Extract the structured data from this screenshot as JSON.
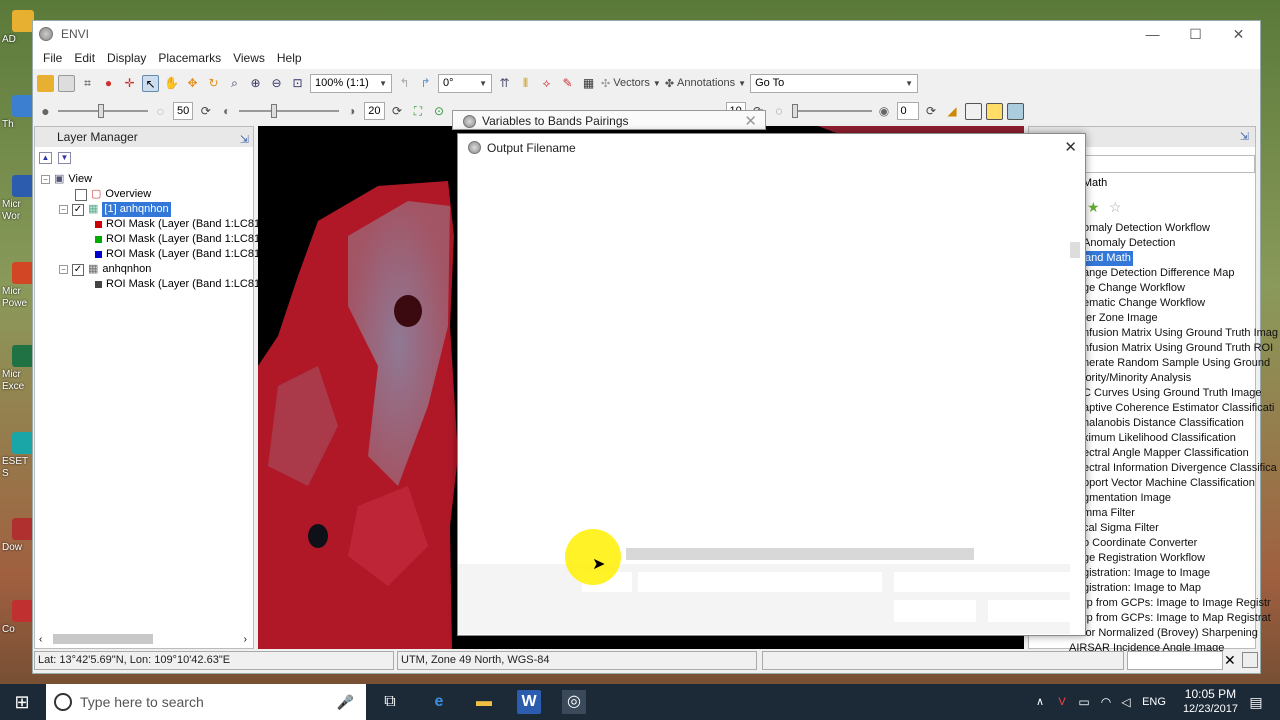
{
  "desktop": {
    "icons": [
      {
        "label": "AD",
        "color": "#e8b030"
      },
      {
        "label": "Th",
        "color": "#3c7fd0"
      },
      {
        "label": "Micr Wor",
        "color": "#2b5cad"
      },
      {
        "label": "Micr Powe",
        "color": "#d24625"
      },
      {
        "label": "Micr Exce",
        "color": "#207245"
      },
      {
        "label": "ESET S",
        "color": "#1aa6a6"
      },
      {
        "label": "Dow",
        "color": "#b03030"
      },
      {
        "label": "Co",
        "color": "#c03030"
      }
    ]
  },
  "window": {
    "title": "ENVI",
    "minimize": "—",
    "maximize": "☐",
    "close": "✕"
  },
  "menu": [
    "File",
    "Edit",
    "Display",
    "Placemarks",
    "Views",
    "Help"
  ],
  "toolbar1": {
    "zoom": "100% (1:1)",
    "rotation": "0°",
    "vectors": "Vectors",
    "annotations": "Annotations",
    "goto": "Go To"
  },
  "toolbar2": {
    "brightness": "50",
    "contrast": "20",
    "sharpen": "10",
    "transparency": "0"
  },
  "layer_manager": {
    "title": "Layer Manager",
    "tree": {
      "view": "View",
      "overview": "Overview",
      "layer1": "[1] anhqnhon",
      "roi1": "ROI Mask (Layer (Band 1:LC81",
      "roi2": "ROI Mask (Layer (Band 1:LC81",
      "roi3": "ROI Mask (Layer (Band 1:LC81",
      "layer2": "anhqnhon",
      "roi4": "ROI Mask (Layer (Band 1:LC81"
    }
  },
  "toolbox": {
    "header": "ebra/Band Math",
    "items": [
      "omaly Detection Workflow",
      "Anomaly Detection",
      "and Math",
      "ange Detection Difference Map",
      "ge Change Workflow",
      "ematic Change Workflow",
      "fer Zone Image",
      "nfusion Matrix Using Ground Truth Imag",
      "nfusion Matrix Using Ground Truth ROI",
      "nerate Random Sample Using Ground",
      "jority/Minority Analysis",
      "C Curves Using Ground Truth Image",
      "aptive Coherence Estimator Classificati",
      "halanobis Distance Classification",
      "ximum Likelihood Classification",
      "ectral Angle Mapper Classification",
      "ectral Information Divergence Classifica",
      "pport Vector Machine Classification",
      "gmentation Image",
      "mma Filter",
      "cal Sigma Filter",
      "o Coordinate Converter",
      "ge Registration Workflow",
      "gistration: Image to Image",
      "gistration: Image to Map",
      "rp from GCPs: Image to Image Registr",
      "rp from GCPs: Image to Map Registrat",
      "Color Normalized (Brovey) Sharpening",
      "AIRSAR Incidence Angle Image"
    ]
  },
  "dialogs": {
    "pairings_title": "Variables to Bands Pairings",
    "output_title": "Output Filename"
  },
  "status": {
    "latlon": "Lat: 13°42'5.69\"N, Lon: 109°10'42.63\"E",
    "projection": "UTM, Zone 49 North, WGS-84"
  },
  "taskbar": {
    "search_placeholder": "Type here to search",
    "language": "ENG",
    "time": "10:05 PM",
    "date": "12/23/2017"
  }
}
